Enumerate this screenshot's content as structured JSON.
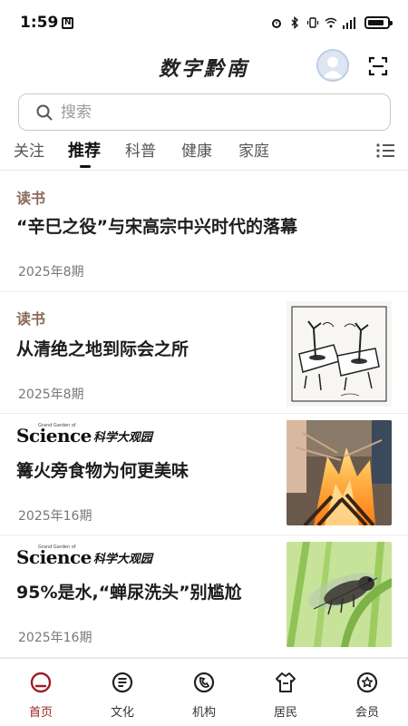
{
  "status": {
    "time": "1:59",
    "nfc": "N",
    "battery_level": 0.85
  },
  "header": {
    "title": "数字黔南"
  },
  "search": {
    "placeholder": "搜索"
  },
  "tabs": [
    {
      "label": "关注",
      "active": false
    },
    {
      "label": "推荐",
      "active": true
    },
    {
      "label": "科普",
      "active": false
    },
    {
      "label": "健康",
      "active": false
    },
    {
      "label": "家庭",
      "active": false
    }
  ],
  "feed": [
    {
      "source": "读书",
      "title": "“辛巳之役”与宋高宗中兴时代的落幕",
      "issue": "2025年8期",
      "thumbnail": null
    },
    {
      "source": "读书",
      "title": "从清绝之地到际会之所",
      "issue": "2025年8期",
      "thumbnail": "sketch-illustration"
    },
    {
      "source_logo": {
        "word": "Science",
        "cn": "科学大观园",
        "tagline": "Grand Garden of"
      },
      "title": "篝火旁食物为何更美味",
      "issue": "2025年16期",
      "thumbnail": "campfire-photo"
    },
    {
      "source_logo": {
        "word": "Science",
        "cn": "科学大观园",
        "tagline": "Grand Garden of"
      },
      "title": "95%是水,“蝉尿洗头”别尴尬",
      "issue": "2025年16期",
      "thumbnail": "cicada-photo"
    }
  ],
  "bottom_nav": [
    {
      "label": "首页",
      "icon": "home-icon",
      "active": true
    },
    {
      "label": "文化",
      "icon": "culture-icon",
      "active": false
    },
    {
      "label": "机构",
      "icon": "institution-icon",
      "active": false
    },
    {
      "label": "居民",
      "icon": "resident-icon",
      "active": false
    },
    {
      "label": "会员",
      "icon": "member-icon",
      "active": false
    }
  ],
  "colors": {
    "accent": "#9c1f23",
    "source_text": "#8b6a5b"
  }
}
